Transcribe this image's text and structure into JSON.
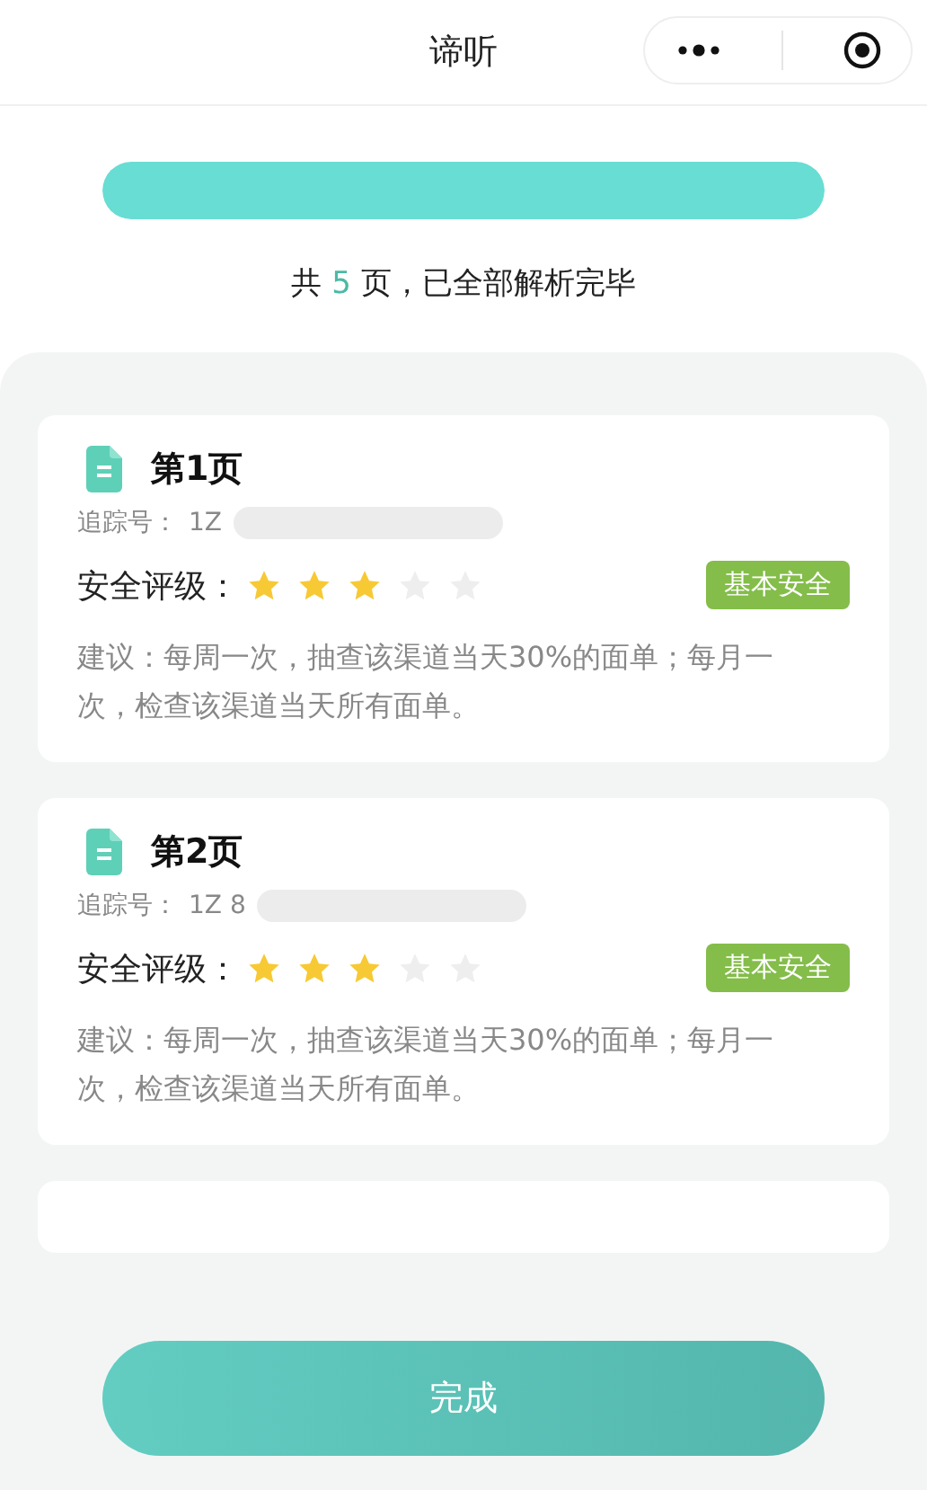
{
  "nav": {
    "title": "谛听"
  },
  "progress": {
    "level": 1
  },
  "summary": {
    "prefix": "共",
    "count": "5",
    "suffix": "页，已全部解析完毕"
  },
  "pages": [
    {
      "title": "第1页",
      "tracking_label": "追踪号：",
      "tracking_value": "1Z",
      "rating_label": "安全评级：",
      "stars": 3,
      "badge": "基本安全",
      "advice": "建议：每周一次，抽查该渠道当天30%的面单；每月一次，检查该渠道当天所有面单。"
    },
    {
      "title": "第2页",
      "tracking_label": "追踪号：",
      "tracking_value": "1Z 8",
      "rating_label": "安全评级：",
      "stars": 3,
      "badge": "基本安全",
      "advice": "建议：每周一次，抽查该渠道当天30%的面单；每月一次，检查该渠道当天所有面单。"
    }
  ],
  "done_button": "完成"
}
